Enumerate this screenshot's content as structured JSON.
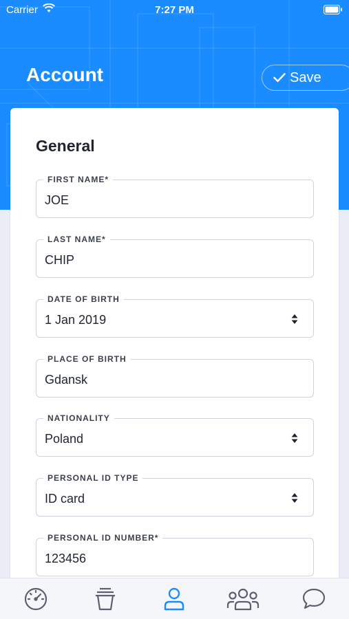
{
  "status_bar": {
    "carrier": "Carrier",
    "time": "7:27 PM"
  },
  "header": {
    "title": "Account",
    "save_label": "Save"
  },
  "colors": {
    "accent": "#1a8cff",
    "tab_active": "#1a8cff",
    "tab_inactive": "#5a6070"
  },
  "form": {
    "section_title": "General",
    "fields": [
      {
        "label": "FIRST NAME*",
        "value": "JOE"
      },
      {
        "label": "LAST NAME*",
        "value": "CHIP"
      },
      {
        "label": "DATE OF BIRTH",
        "value": "1 Jan 2019"
      },
      {
        "label": "PLACE OF BIRTH",
        "value": "Gdansk"
      },
      {
        "label": "NATIONALITY",
        "value": "Poland"
      },
      {
        "label": "PERSONAL ID TYPE",
        "value": "ID card"
      },
      {
        "label": "PERSONAL ID NUMBER*",
        "value": "123456"
      }
    ]
  },
  "tabs": [
    {
      "icon": "dashboard-gauge-icon",
      "active": false
    },
    {
      "icon": "trash-bin-icon",
      "active": false
    },
    {
      "icon": "user-icon",
      "active": true
    },
    {
      "icon": "group-users-icon",
      "active": false
    },
    {
      "icon": "chat-bubble-icon",
      "active": false
    }
  ]
}
